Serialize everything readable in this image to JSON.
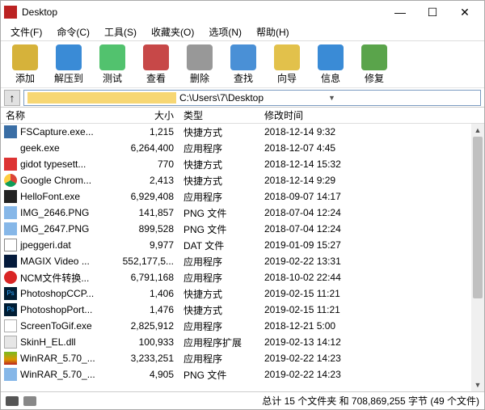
{
  "titlebar": {
    "title": "Desktop"
  },
  "menu": [
    "文件(F)",
    "命令(C)",
    "工具(S)",
    "收藏夹(O)",
    "选项(N)",
    "帮助(H)"
  ],
  "toolbar": [
    {
      "label": "添加",
      "color": "#d6b23a"
    },
    {
      "label": "解压到",
      "color": "#3a8bd6"
    },
    {
      "label": "测试",
      "color": "#52c26e"
    },
    {
      "label": "查看",
      "color": "#c74848"
    },
    {
      "label": "删除",
      "color": "#989898"
    },
    {
      "label": "查找",
      "color": "#4a90d6"
    },
    {
      "label": "向导",
      "color": "#e2c14b"
    },
    {
      "label": "信息",
      "color": "#3a8bd6"
    },
    {
      "label": "修复",
      "color": "#5aa44b"
    }
  ],
  "address": {
    "path": "C:\\Users\\7\\Desktop"
  },
  "columns": {
    "name": "名称",
    "size": "大小",
    "type": "类型",
    "date": "修改时间"
  },
  "files": [
    {
      "icon": "ic-exe-fs",
      "name": "FSCapture.exe...",
      "size": "1,215",
      "type": "快捷方式",
      "date": "2018-12-14 9:32"
    },
    {
      "icon": "ic-geek",
      "name": "geek.exe",
      "size": "6,264,400",
      "type": "应用程序",
      "date": "2018-12-07 4:45"
    },
    {
      "icon": "ic-gidot",
      "name": "gidot typesett...",
      "size": "770",
      "type": "快捷方式",
      "date": "2018-12-14 15:32"
    },
    {
      "icon": "ic-chrome",
      "name": "Google Chrom...",
      "size": "2,413",
      "type": "快捷方式",
      "date": "2018-12-14 9:29"
    },
    {
      "icon": "ic-hello",
      "name": "HelloFont.exe",
      "size": "6,929,408",
      "type": "应用程序",
      "date": "2018-09-07 14:17"
    },
    {
      "icon": "ic-png",
      "name": "IMG_2646.PNG",
      "size": "141,857",
      "type": "PNG 文件",
      "date": "2018-07-04 12:24"
    },
    {
      "icon": "ic-png",
      "name": "IMG_2647.PNG",
      "size": "899,528",
      "type": "PNG 文件",
      "date": "2018-07-04 12:24"
    },
    {
      "icon": "ic-dat",
      "name": "jpeggeri.dat",
      "size": "9,977",
      "type": "DAT 文件",
      "date": "2019-01-09 15:27"
    },
    {
      "icon": "ic-magix",
      "name": "MAGIX Video ...",
      "size": "552,177,5...",
      "type": "应用程序",
      "date": "2019-02-22 13:31"
    },
    {
      "icon": "ic-ncm",
      "name": "NCM文件转换...",
      "size": "6,791,168",
      "type": "应用程序",
      "date": "2018-10-02 22:44"
    },
    {
      "icon": "ic-ps",
      "name": "PhotoshopCCP...",
      "size": "1,406",
      "type": "快捷方式",
      "date": "2019-02-15 11:21"
    },
    {
      "icon": "ic-ps",
      "name": "PhotoshopPort...",
      "size": "1,476",
      "type": "快捷方式",
      "date": "2019-02-15 11:21"
    },
    {
      "icon": "ic-s2g",
      "name": "ScreenToGif.exe",
      "size": "2,825,912",
      "type": "应用程序",
      "date": "2018-12-21 5:00"
    },
    {
      "icon": "ic-dll",
      "name": "SkinH_EL.dll",
      "size": "100,933",
      "type": "应用程序扩展",
      "date": "2019-02-13 14:12"
    },
    {
      "icon": "ic-rar",
      "name": "WinRAR_5.70_...",
      "size": "3,233,251",
      "type": "应用程序",
      "date": "2019-02-22 14:23"
    },
    {
      "icon": "ic-png",
      "name": "WinRAR_5.70_...",
      "size": "4,905",
      "type": "PNG 文件",
      "date": "2019-02-22 14:23"
    }
  ],
  "statusbar": {
    "text": "总计 15 个文件夹 和 708,869,255 字节 (49 个文件)"
  }
}
